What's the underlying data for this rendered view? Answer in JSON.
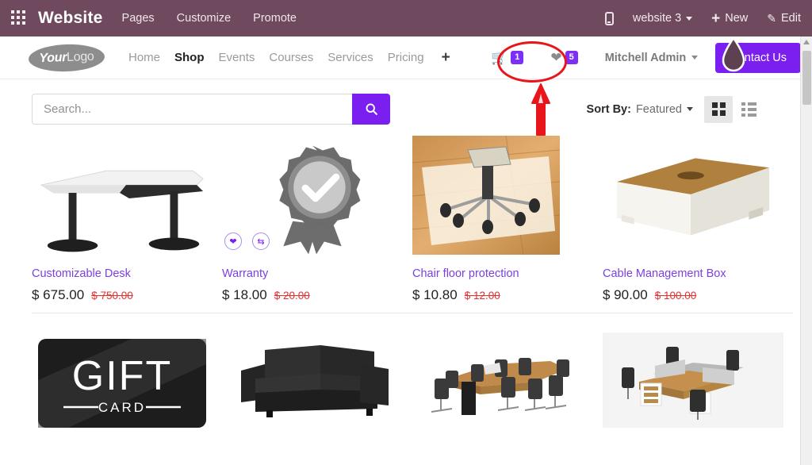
{
  "systembar": {
    "apps_icon": "apps-grid-icon",
    "title": "Website",
    "menu": [
      "Pages",
      "Customize",
      "Promote"
    ],
    "mobile_icon": "mobile-preview-icon",
    "website_selector": "website 3",
    "new_label": "New",
    "edit_label": "Edit",
    "bg_color": "#6f4a5e"
  },
  "site_header": {
    "logo": {
      "bold": "Your",
      "light": "Logo"
    },
    "nav": [
      {
        "label": "Home",
        "active": false
      },
      {
        "label": "Shop",
        "active": true
      },
      {
        "label": "Events",
        "active": false
      },
      {
        "label": "Courses",
        "active": false
      },
      {
        "label": "Services",
        "active": false
      },
      {
        "label": "Pricing",
        "active": false
      }
    ],
    "nav_add": "+",
    "cart": {
      "icon": "shopping-cart-icon",
      "count": "1"
    },
    "wishlist": {
      "icon": "heart-icon",
      "count": "5"
    },
    "user": "Mitchell Admin",
    "cta": "Contact Us",
    "cta_color": "#7b1ff0"
  },
  "toolbar": {
    "search_placeholder": "Search...",
    "search_value": "",
    "search_icon": "magnifier-icon",
    "sort_label": "Sort By:",
    "sort_value": "Featured",
    "grid_view_icon": "grid-view-icon",
    "list_view_icon": "list-view-icon",
    "active_view": "grid"
  },
  "products_row1": [
    {
      "name": "Customizable Desk",
      "price": "$ 675.00",
      "old_price": "$ 750.00",
      "art": "desk"
    },
    {
      "name": "Warranty",
      "price": "$ 18.00",
      "old_price": "$ 20.00",
      "art": "badge",
      "hover_icons": [
        "heart-icon",
        "compare-icon"
      ]
    },
    {
      "name": "Chair floor protection",
      "price": "$ 10.80",
      "old_price": "$ 12.00",
      "art": "floormat"
    },
    {
      "name": "Cable Management Box",
      "price": "$ 90.00",
      "old_price": "$ 100.00",
      "art": "cablebox"
    }
  ],
  "products_row2": [
    {
      "name": "",
      "art": "giftcard",
      "card_text": "GIFT",
      "card_sub": "CARD"
    },
    {
      "name": "",
      "art": "sofa"
    },
    {
      "name": "",
      "art": "conference"
    },
    {
      "name": "",
      "art": "workstation"
    }
  ],
  "annotations": {
    "ellipse": "red-ellipse-highlight",
    "arrow": "red-arrow-pointing-up",
    "cursor": "mouse-cursor"
  }
}
